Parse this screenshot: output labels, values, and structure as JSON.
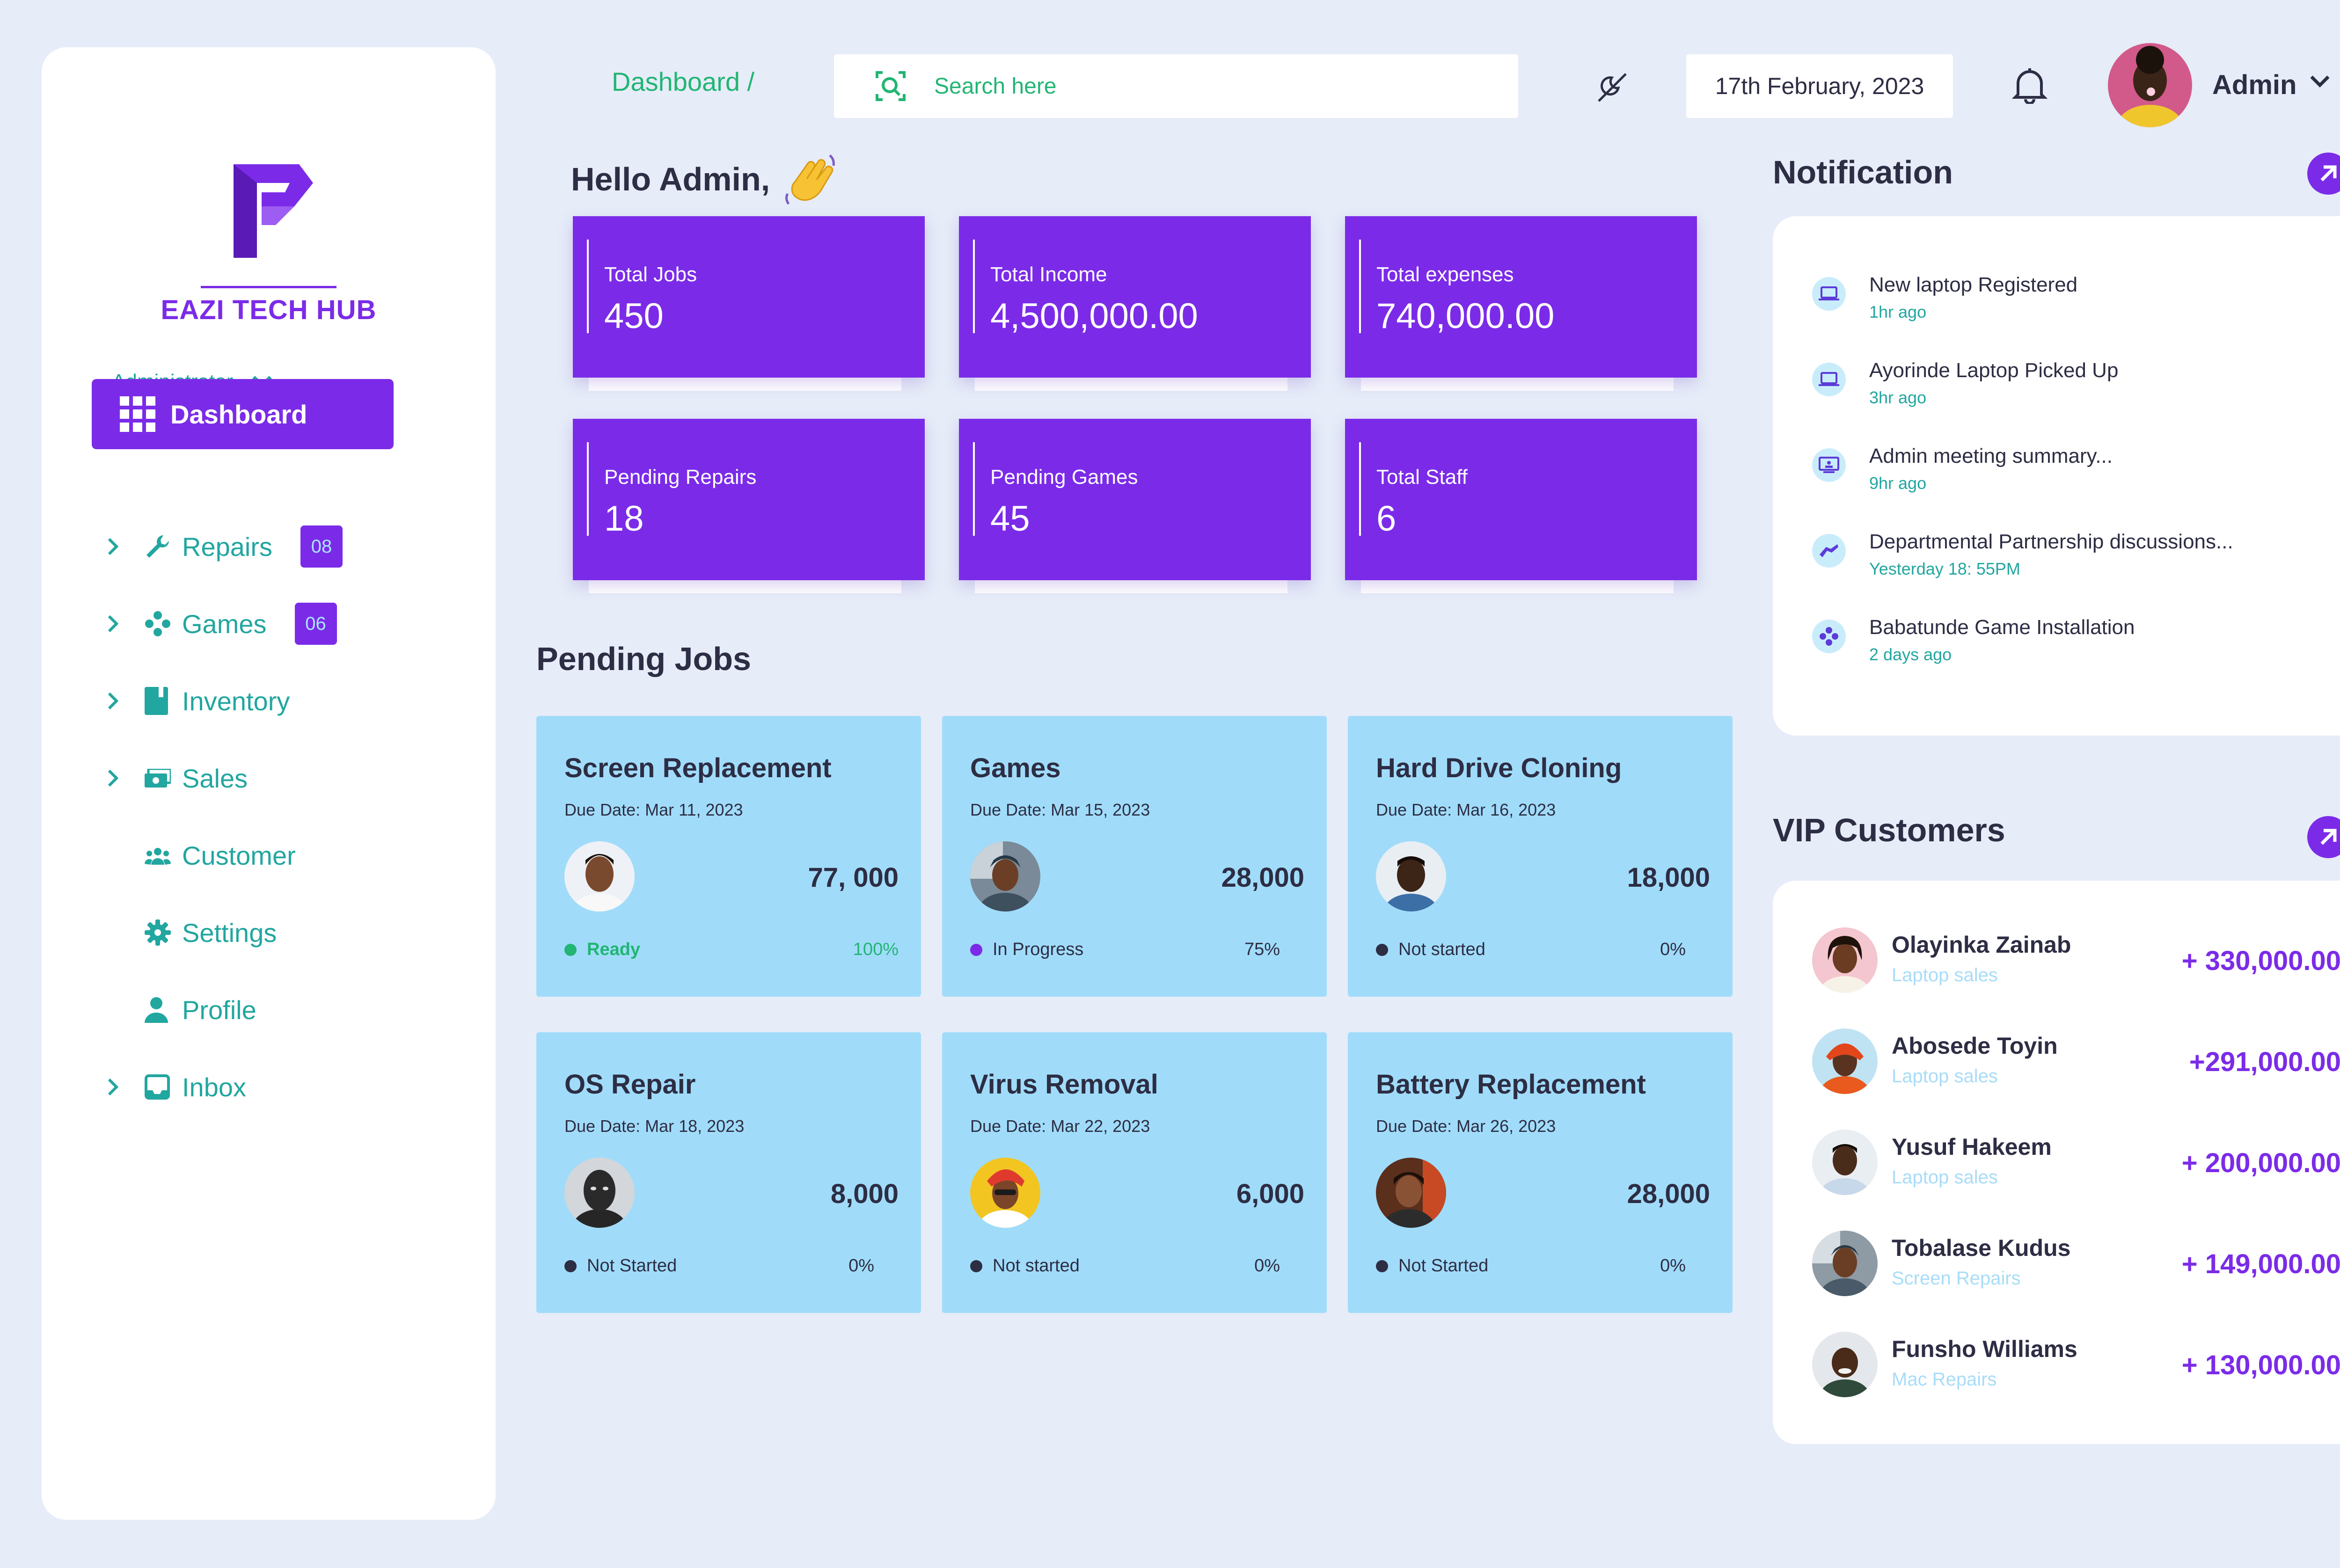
{
  "app": {
    "brand": "EAZI TECH HUB",
    "accent": "#7b2be8",
    "teal": "#22a6a0",
    "green": "#22b573"
  },
  "header": {
    "breadcrumb": "Dashboard /",
    "search_placeholder": "Search here",
    "date": "17th February, 2023",
    "user": "Admin"
  },
  "sidebar": {
    "role": "Administrator",
    "active": {
      "label": "Dashboard",
      "icon": "grid-icon"
    },
    "items": [
      {
        "label": "Repairs",
        "icon": "wrench-icon",
        "badge": "08",
        "chevron": true
      },
      {
        "label": "Games",
        "icon": "gamepad-icon",
        "badge": "06",
        "chevron": true
      },
      {
        "label": "Inventory",
        "icon": "book-icon",
        "chevron": true
      },
      {
        "label": "Sales",
        "icon": "cash-icon",
        "chevron": true
      },
      {
        "label": "Customer",
        "icon": "users-icon",
        "chevron": false
      },
      {
        "label": "Settings",
        "icon": "gear-icon",
        "chevron": false
      },
      {
        "label": "Profile",
        "icon": "user-icon",
        "chevron": false
      },
      {
        "label": "Inbox",
        "icon": "inbox-icon",
        "chevron": true
      }
    ]
  },
  "greeting": "Hello Admin,",
  "stats": [
    {
      "label": "Total Jobs",
      "value": "450"
    },
    {
      "label": "Total Income",
      "value": "4,500,000.00"
    },
    {
      "label": "Total expenses",
      "value": "740,000.00"
    },
    {
      "label": "Pending Repairs",
      "value": "18"
    },
    {
      "label": "Pending Games",
      "value": "45"
    },
    {
      "label": "Total Staff",
      "value": "6"
    }
  ],
  "pending_jobs": {
    "title": "Pending Jobs",
    "items": [
      {
        "title": "Screen Replacement",
        "due": "Due Date: Mar 11, 2023",
        "amount": "77, 000",
        "status": "Ready",
        "pct": "100%",
        "status_color": "#22b573",
        "progress": 1.0
      },
      {
        "title": "Games",
        "due": "Due Date: Mar 15, 2023",
        "amount": "28,000",
        "status": "In Progress",
        "pct": "75%",
        "status_color": "#7b2be8",
        "progress": 0.75
      },
      {
        "title": "Hard Drive Cloning",
        "due": "Due Date: Mar 16, 2023",
        "amount": "18,000",
        "status": "Not started",
        "pct": "0%",
        "status_color": "#2d2d44",
        "progress": 0
      },
      {
        "title": "OS Repair",
        "due": "Due Date: Mar 18, 2023",
        "amount": "8,000",
        "status": "Not Started",
        "pct": "0%",
        "status_color": "#2d2d44",
        "progress": 0
      },
      {
        "title": "Virus Removal",
        "due": "Due Date: Mar 22, 2023",
        "amount": "6,000",
        "status": "Not started",
        "pct": "0%",
        "status_color": "#2d2d44",
        "progress": 0
      },
      {
        "title": "Battery Replacement",
        "due": "Due Date: Mar 26, 2023",
        "amount": "28,000",
        "status": "Not Started",
        "pct": "0%",
        "status_color": "#2d2d44",
        "progress": 0
      }
    ]
  },
  "notifications": {
    "title": "Notification",
    "items": [
      {
        "text": "New laptop Registered",
        "time": "1hr ago",
        "icon": "laptop-icon"
      },
      {
        "text": "Ayorinde Laptop Picked Up",
        "time": "3hr ago",
        "icon": "laptop-icon"
      },
      {
        "text": "Admin meeting summary...",
        "time": "9hr ago",
        "icon": "presentation-icon"
      },
      {
        "text": "Departmental Partnership discussions...",
        "time": "Yesterday 18: 55PM",
        "icon": "handshake-icon"
      },
      {
        "text": "Babatunde Game Installation",
        "time": "2 days ago",
        "icon": "gamepad-icon"
      }
    ]
  },
  "vip": {
    "title": "VIP Customers",
    "items": [
      {
        "name": "Olayinka Zainab",
        "category": "Laptop sales",
        "amount": "+ 330,000.00"
      },
      {
        "name": "Abosede Toyin",
        "category": "Laptop sales",
        "amount": "+291,000.00"
      },
      {
        "name": "Yusuf Hakeem",
        "category": "Laptop sales",
        "amount": "+ 200,000.00"
      },
      {
        "name": "Tobalase Kudus",
        "category": "Screen Repairs",
        "amount": "+ 149,000.00"
      },
      {
        "name": "Funsho Williams",
        "category": "Mac Repairs",
        "amount": "+ 130,000.00"
      }
    ]
  }
}
